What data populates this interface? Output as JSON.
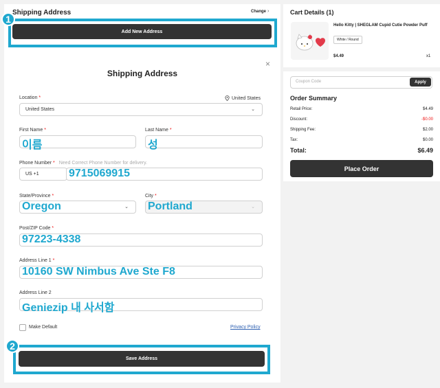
{
  "shipping_header": {
    "title": "Shipping Address",
    "change_label": "Change",
    "chevron": "›",
    "add_button": "Add New Address"
  },
  "badges": {
    "one": "1",
    "two": "2"
  },
  "modal": {
    "title": "Shipping Address",
    "close": "×",
    "location": {
      "label": "Location",
      "required": "*",
      "value": "United States",
      "country_hint": "United States",
      "chevron": "⌄"
    },
    "first_name": {
      "label": "First Name",
      "required": "*",
      "value": "이름"
    },
    "last_name": {
      "label": "Last Name",
      "required": "*",
      "value": "성"
    },
    "phone": {
      "label": "Phone Number",
      "required": "*",
      "hint": "Need Correct Phone Number for delivery.",
      "prefix": "US +1",
      "value": "9715069915"
    },
    "state": {
      "label": "State/Province",
      "required": "*",
      "value": "Oregon",
      "chevron": "⌄"
    },
    "city": {
      "label": "City",
      "required": "*",
      "value": "Portland",
      "chevron": "⌄"
    },
    "zip": {
      "label": "Post/ZIP Code",
      "required": "*",
      "value": "97223-4338"
    },
    "address1": {
      "label": "Address Line 1",
      "required": "*",
      "value": "10160 SW Nimbus Ave Ste F8"
    },
    "address2": {
      "label": "Address Line 2",
      "value": "Geniezip 내 사서함"
    },
    "make_default": "Make Default",
    "privacy_policy": "Privacy Policy",
    "save_button": "Save Address"
  },
  "cart": {
    "title": "Cart Details (1)",
    "product_name": "Hello Kitty | SHEGLAM Cupid Cutie Powder Puff",
    "variant": "White / Round",
    "price": "$4.49",
    "qty": "x1"
  },
  "summary": {
    "coupon_placeholder": "Coupon Code",
    "apply_label": "Apply",
    "title": "Order Summary",
    "rows": [
      {
        "label": "Retail Price:",
        "value": "$4.49"
      },
      {
        "label": "Discount:",
        "value": "-$0.00"
      },
      {
        "label": "Shipping Fee:",
        "value": "$2.00"
      },
      {
        "label": "Tax:",
        "value": "$0.00"
      }
    ],
    "total_label": "Total:",
    "total_value": "$6.49",
    "place_order": "Place Order"
  },
  "colors": {
    "highlight": "#1fa8cf",
    "button": "#333333",
    "error": "#e11111"
  },
  "icons": {
    "location": "map-pin-icon",
    "close": "close-icon",
    "chevron": "chevron-down-icon"
  }
}
